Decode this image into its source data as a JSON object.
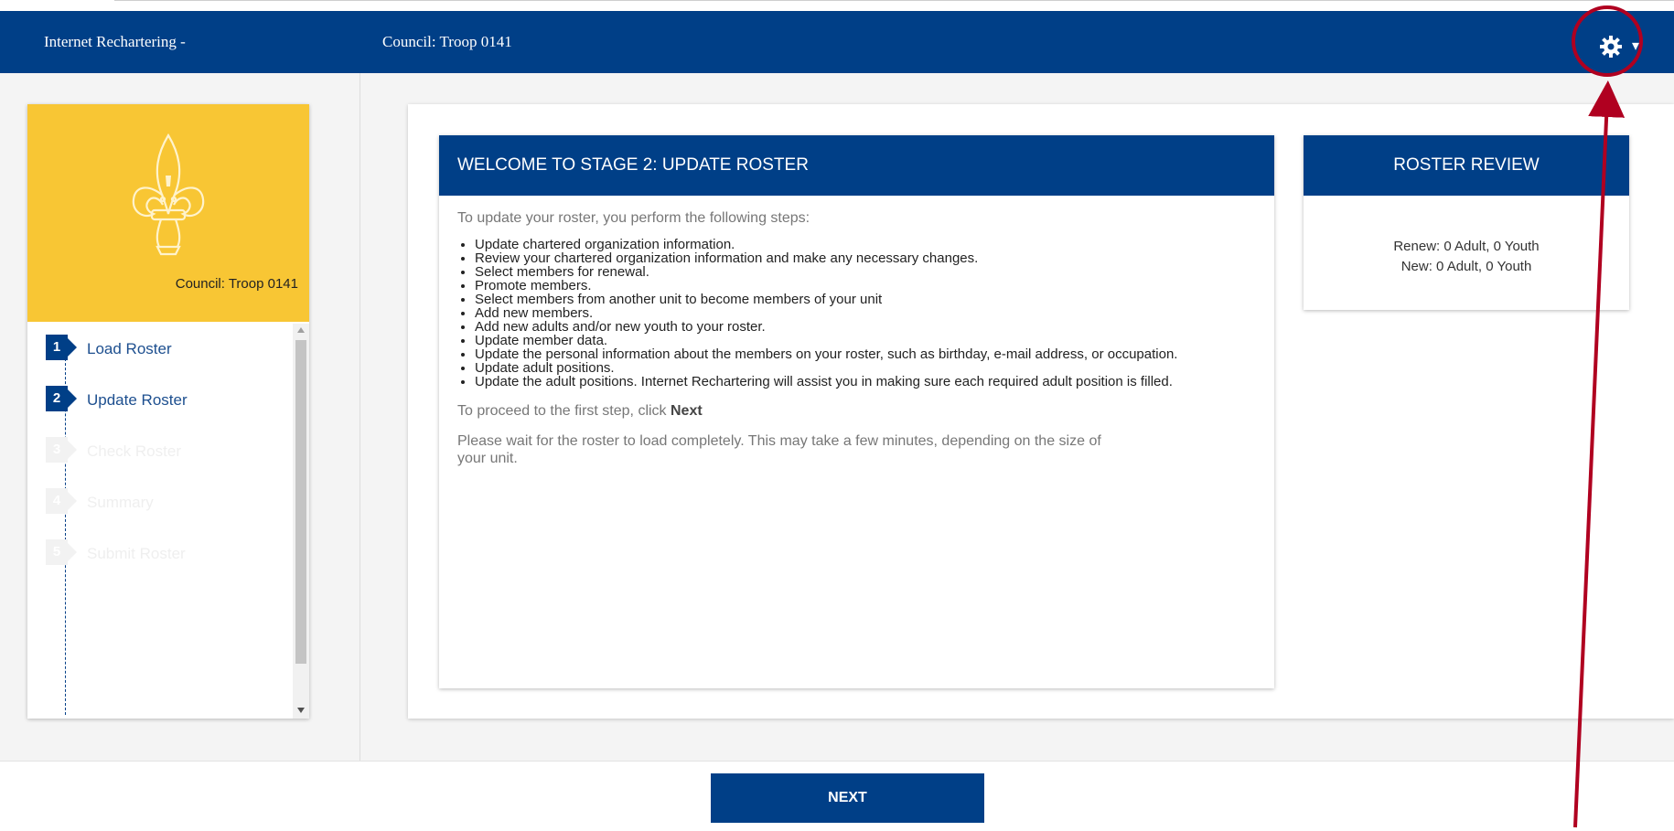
{
  "header": {
    "app_title": "Internet Rechartering -",
    "council": "Council: Troop 0141",
    "settings_icon": "gear-icon",
    "dropdown_icon": "caret-down-icon"
  },
  "sidebar": {
    "council_label": "Council: Troop 0141",
    "logo": "fleur-de-lis-logo",
    "steps": [
      {
        "num": "1",
        "label": "Load Roster",
        "state": "complete"
      },
      {
        "num": "2",
        "label": "Update Roster",
        "state": "active"
      },
      {
        "num": "3",
        "label": "Check Roster",
        "state": "disabled"
      },
      {
        "num": "4",
        "label": "Summary",
        "state": "disabled"
      },
      {
        "num": "5",
        "label": "Submit Roster",
        "state": "disabled"
      }
    ]
  },
  "welcome": {
    "title": "WELCOME TO STAGE 2: UPDATE ROSTER",
    "intro": "To update your roster, you perform the following steps:",
    "items": [
      "Update chartered organization information.",
      "Review your chartered organization information and make any necessary changes.",
      "Select members for renewal.",
      "Promote members.",
      "Select members from another unit to become members of your unit",
      "Add new members.",
      "Add new adults and/or new youth to your roster.",
      "Update member data.",
      "Update the personal information about the members on your roster, such as birthday, e-mail address, or occupation.",
      "Update adult positions.",
      "Update the adult positions. Internet Rechartering will assist you in making sure each required adult position is filled."
    ],
    "proceed_prefix": "To proceed to the first step, click ",
    "proceed_bold": "Next",
    "wait": "Please wait for the roster to load completely. This may take a few minutes, depending on the size of your unit."
  },
  "review": {
    "title": "ROSTER REVIEW",
    "renew": "Renew: 0 Adult, 0 Youth",
    "new": "New: 0 Adult, 0 Youth"
  },
  "footer": {
    "next_label": "NEXT"
  },
  "colors": {
    "brand_blue": "#003f87",
    "banner_yellow": "#f8c634",
    "annotation_red": "#b00020"
  }
}
